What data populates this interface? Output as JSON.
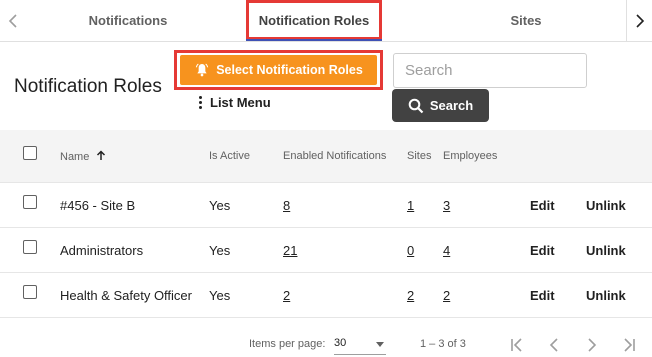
{
  "tabs": [
    {
      "label": "Notifications"
    },
    {
      "label": "Notification Roles"
    },
    {
      "label": "Sites"
    }
  ],
  "header": {
    "title": "Notification Roles",
    "select_roles_label": "Select Notification Roles",
    "list_menu_label": "List Menu"
  },
  "search": {
    "placeholder": "Search",
    "value": "",
    "button_label": "Search"
  },
  "table": {
    "columns": [
      "Name",
      "Is Active",
      "Enabled Notifications",
      "Sites",
      "Employees"
    ],
    "sort": {
      "column": "Name",
      "direction": "ascending"
    },
    "rows": [
      {
        "name": "#456 - Site B",
        "active": "Yes",
        "notifications": "8",
        "sites": "1",
        "employees": "3",
        "edit": "Edit",
        "unlink": "Unlink"
      },
      {
        "name": "Administrators",
        "active": "Yes",
        "notifications": "21",
        "sites": "0",
        "employees": "4",
        "edit": "Edit",
        "unlink": "Unlink"
      },
      {
        "name": "Health & Safety Officer",
        "active": "Yes",
        "notifications": "2",
        "sites": "2",
        "employees": "2",
        "edit": "Edit",
        "unlink": "Unlink"
      }
    ]
  },
  "paginator": {
    "items_per_page_label": "Items per page:",
    "items_per_page": "30",
    "range": "1 – 3 of 3"
  },
  "colors": {
    "accent_orange": "#f7931e",
    "highlight_red": "#e53935",
    "search_button": "#424242",
    "tab_ink": "#3f51b5"
  },
  "icons": [
    "chevron-left-icon",
    "chevron-right-icon",
    "bell-icon",
    "more-vert-icon",
    "search-icon",
    "arrow-up-icon",
    "first-page-icon",
    "previous-page-icon",
    "next-page-icon",
    "last-page-icon"
  ]
}
